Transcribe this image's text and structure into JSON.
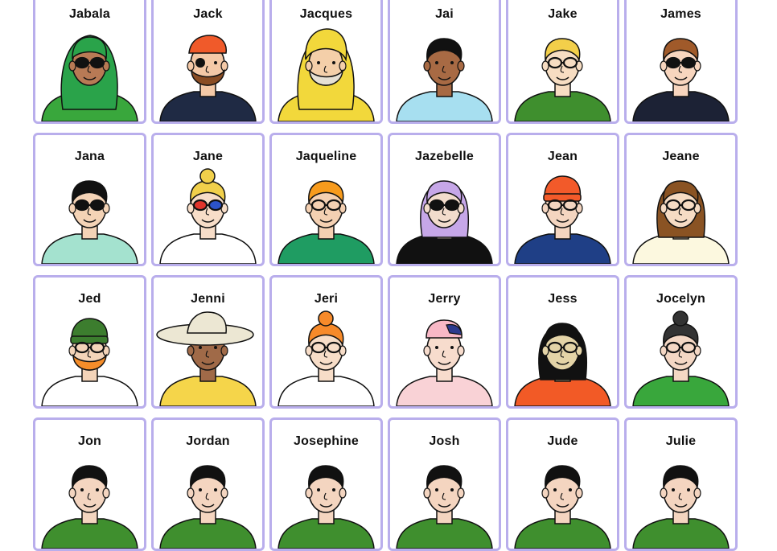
{
  "cards": [
    {
      "name": "Jabala",
      "skin": "#b87a55",
      "hair": "#2aa34a",
      "shirt": "#39a73c",
      "glasses": "sun",
      "hat": "hijab"
    },
    {
      "name": "Jack",
      "skin": "#f4c9a7",
      "hair": "#8a4d24",
      "shirt": "#1f2a44",
      "glasses": "patch",
      "hat": "bandana"
    },
    {
      "name": "Jacques",
      "skin": "#f4cfa9",
      "hair": "#e6e0d4",
      "shirt": "#f2d83b",
      "glasses": "none",
      "hat": "raincoat"
    },
    {
      "name": "Jai",
      "skin": "#a86a44",
      "hair": "#111111",
      "shirt": "#a7dff0",
      "glasses": "none",
      "hat": "none"
    },
    {
      "name": "Jake",
      "skin": "#f7ddc2",
      "hair": "#f3cf4a",
      "shirt": "#3f8f2e",
      "glasses": "clear",
      "hat": "none"
    },
    {
      "name": "James",
      "skin": "#f7d5be",
      "hair": "#a05a2a",
      "shirt": "#1c2235",
      "glasses": "sun",
      "hat": "none"
    },
    {
      "name": "Jana",
      "skin": "#f4d3b6",
      "hair": "#111111",
      "shirt": "#a4e2cf",
      "glasses": "sun",
      "hat": "none"
    },
    {
      "name": "Jane",
      "skin": "#f7ddc8",
      "hair": "#f1d04b",
      "shirt": "#ffffff",
      "glasses": "color",
      "hat": "bun"
    },
    {
      "name": "Jaqueline",
      "skin": "#f4d0b2",
      "hair": "#f79b1d",
      "shirt": "#1f9c62",
      "glasses": "clear",
      "hat": "none"
    },
    {
      "name": "Jazebelle",
      "skin": "#f2dccc",
      "hair": "#c6a7e8",
      "shirt": "#111111",
      "glasses": "sun",
      "hat": "none"
    },
    {
      "name": "Jean",
      "skin": "#f4d5c0",
      "hair": "#f25a2a",
      "shirt": "#1f3f86",
      "glasses": "clear",
      "hat": "beanie"
    },
    {
      "name": "Jeane",
      "skin": "#f6dcc4",
      "hair": "#8a5323",
      "shirt": "#fcf8df",
      "glasses": "clear",
      "hat": "none"
    },
    {
      "name": "Jed",
      "skin": "#f4d4b9",
      "hair": "#f58d2a",
      "shirt": "#ffffff",
      "glasses": "clear",
      "hat": "beanie-green"
    },
    {
      "name": "Jenni",
      "skin": "#a06a48",
      "hair": "#ece7d3",
      "shirt": "#f5d54a",
      "glasses": "none",
      "hat": "sunhat"
    },
    {
      "name": "Jeri",
      "skin": "#f7ddc8",
      "hair": "#f78a2a",
      "shirt": "#ffffff",
      "glasses": "clear",
      "hat": "bun"
    },
    {
      "name": "Jerry",
      "skin": "#f7dccd",
      "hair": "#f8b8c6",
      "shirt": "#f9d2d6",
      "glasses": "none",
      "hat": "cap"
    },
    {
      "name": "Jess",
      "skin": "#e4d4a7",
      "hair": "#111111",
      "shirt": "#f25a26",
      "glasses": "clear",
      "hat": "none"
    },
    {
      "name": "Jocelyn",
      "skin": "#f4d7c4",
      "hair": "#333333",
      "shirt": "#39a73c",
      "glasses": "clear",
      "hat": "bun"
    },
    {
      "name": "Jon",
      "skin": "#f4d5c0",
      "hair": "#111111",
      "shirt": "#3f8f2e",
      "glasses": "none",
      "hat": "none"
    },
    {
      "name": "Jordan",
      "skin": "#f4d5c0",
      "hair": "#111111",
      "shirt": "#3f8f2e",
      "glasses": "none",
      "hat": "none"
    },
    {
      "name": "Josephine",
      "skin": "#f4d5c0",
      "hair": "#111111",
      "shirt": "#3f8f2e",
      "glasses": "none",
      "hat": "none"
    },
    {
      "name": "Josh",
      "skin": "#f4d5c0",
      "hair": "#111111",
      "shirt": "#3f8f2e",
      "glasses": "none",
      "hat": "none"
    },
    {
      "name": "Jude",
      "skin": "#f4d5c0",
      "hair": "#111111",
      "shirt": "#3f8f2e",
      "glasses": "none",
      "hat": "none"
    },
    {
      "name": "Julie",
      "skin": "#f4d5c0",
      "hair": "#111111",
      "shirt": "#3f8f2e",
      "glasses": "none",
      "hat": "none"
    }
  ],
  "colors": {
    "card_border": "#b9aeec",
    "ink": "#111111"
  }
}
